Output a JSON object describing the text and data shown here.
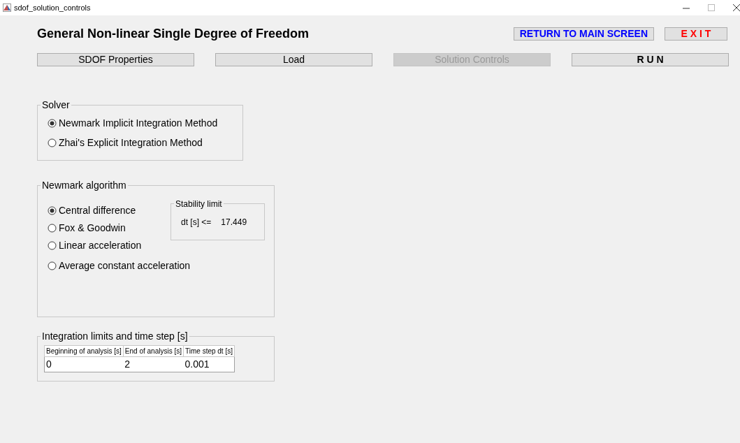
{
  "window": {
    "title": "sdof_solution_controls"
  },
  "heading": "General Non-linear Single Degree of Freedom",
  "top_buttons": [
    {
      "label": "RETURN TO MAIN SCREEN",
      "color": "#0000ff"
    },
    {
      "label": "E X I T",
      "color": "#ff0000"
    }
  ],
  "tabs": [
    {
      "label": "SDOF Properties",
      "selected": false,
      "bold": false
    },
    {
      "label": "Load",
      "selected": false,
      "bold": false
    },
    {
      "label": "Solution Controls",
      "selected": true,
      "bold": false
    },
    {
      "label": "R U N",
      "selected": false,
      "bold": true
    }
  ],
  "solver": {
    "title": "Solver",
    "options": [
      {
        "label": "Newmark Implicit Integration Method",
        "selected": true
      },
      {
        "label": "Zhai's Explicit Integration Method",
        "selected": false
      }
    ]
  },
  "newmark": {
    "title": "Newmark algorithm",
    "options": [
      {
        "label": "Central difference",
        "selected": true
      },
      {
        "label": "Fox & Goodwin",
        "selected": false
      },
      {
        "label": "Linear acceleration",
        "selected": false
      },
      {
        "label": "Average constant acceleration",
        "selected": false
      }
    ],
    "stability": {
      "title": "Stability limit",
      "label": "dt [s] <=",
      "value": "17.449"
    }
  },
  "integration": {
    "title": "Integration limits and time step [s]",
    "columns": [
      "Beginning of analysis [s]",
      "End of analysis [s]",
      "Time step dt [s]"
    ],
    "rows": [
      [
        "0",
        "2",
        "0.001"
      ]
    ]
  }
}
